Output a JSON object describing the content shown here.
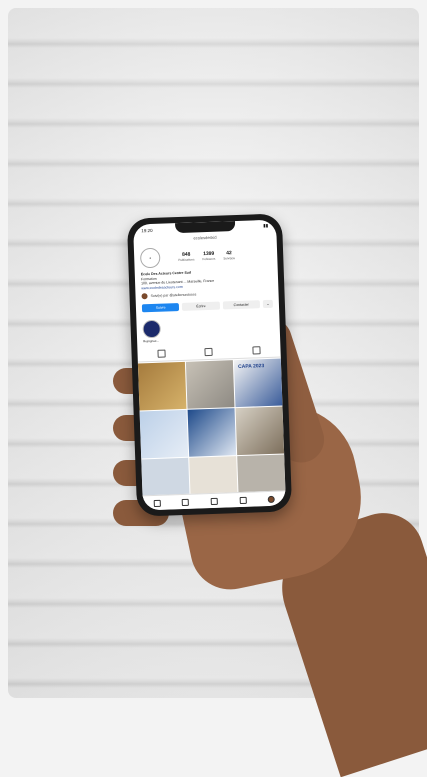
{
  "scene": {
    "description_icon": "smartphone-in-hand"
  },
  "phone": {
    "status_time": "19:20",
    "username": "ecolesdeskid",
    "profile": {
      "posts": "848",
      "followers": "1399",
      "following": "42",
      "posts_label": "Publications",
      "followers_label": "Followers",
      "following_label": "Suivi(e)s",
      "name": "École Des Acteurs Centre Sud",
      "category": "Formation",
      "address": "100, avenue du Lieutenant ... Marseille, France",
      "link": "www.ecoledesacteurs.com",
      "followed_by": "Suivi(e) par @ateliersastuces"
    },
    "buttons": {
      "follow": "Suivre",
      "message": "Écrire",
      "contact": "Contacter",
      "more": "⌄"
    },
    "highlight": {
      "label": "Rejoignez..."
    },
    "grid_texts": {
      "cell3": "CAPA 2023"
    }
  }
}
